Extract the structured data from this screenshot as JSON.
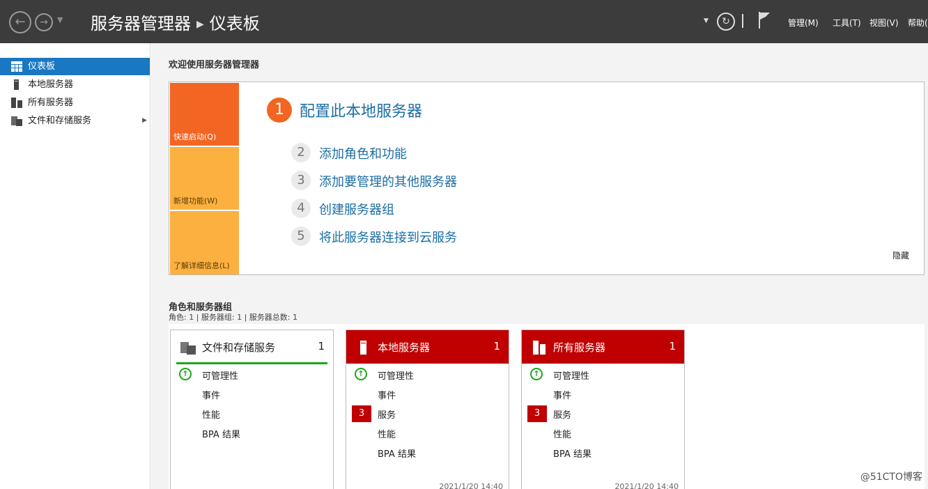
{
  "header": {
    "title_main": "服务器管理器",
    "title_page": "仪表板",
    "menus": [
      "管理(M)",
      "工具(T)",
      "视图(V)",
      "帮助("
    ]
  },
  "sidebar": {
    "items": [
      {
        "label": "仪表板",
        "icon": "dashboard-icon"
      },
      {
        "label": "本地服务器",
        "icon": "server-icon"
      },
      {
        "label": "所有服务器",
        "icon": "servers-icon"
      },
      {
        "label": "文件和存储服务",
        "icon": "file-storage-icon"
      }
    ]
  },
  "welcome": {
    "heading": "欢迎使用服务器管理器",
    "tiles": [
      "快速启动(Q)",
      "新增功能(W)",
      "了解详细信息(L)"
    ],
    "step1": {
      "num": "1",
      "label": "配置此本地服务器"
    },
    "steps": [
      {
        "num": "2",
        "label": "添加角色和功能"
      },
      {
        "num": "3",
        "label": "添加要管理的其他服务器"
      },
      {
        "num": "4",
        "label": "创建服务器组"
      },
      {
        "num": "5",
        "label": "将此服务器连接到云服务"
      }
    ],
    "hide": "隐藏"
  },
  "roles": {
    "heading": "角色和服务器组",
    "summary": "角色: 1 | 服务器组: 1 | 服务器总数: 1",
    "cards": [
      {
        "title": "文件和存储服务",
        "count": "1",
        "rows": [
          "可管理性",
          "事件",
          "性能",
          "BPA 结果"
        ]
      },
      {
        "title": "本地服务器",
        "count": "1",
        "rows": [
          "可管理性",
          "事件",
          "服务",
          "性能",
          "BPA 结果"
        ],
        "badge": "3",
        "time": "2021/1/20 14:40"
      },
      {
        "title": "所有服务器",
        "count": "1",
        "rows": [
          "可管理性",
          "事件",
          "服务",
          "性能",
          "BPA 结果"
        ],
        "badge": "3",
        "time": "2021/1/20 14:40"
      }
    ]
  },
  "colors": {
    "accent": "#1a78c2",
    "alert": "#c00000",
    "ok": "#1aa81a",
    "quick": "#f26522",
    "tile": "#fbb040"
  },
  "watermark": "@51CTO博客"
}
